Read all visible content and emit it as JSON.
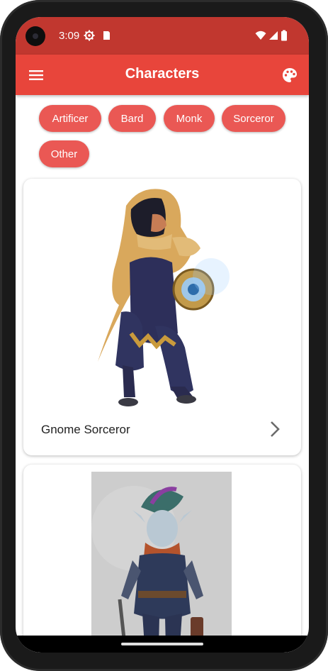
{
  "status": {
    "time": "3:09",
    "icons": [
      "settings-icon",
      "sd-card-icon",
      "wifi-icon",
      "signal-icon",
      "battery-icon"
    ]
  },
  "appbar": {
    "title": "Characters",
    "menu_icon": "menu-icon",
    "palette_icon": "palette-icon"
  },
  "filters": {
    "chips": [
      "Artificer",
      "Bard",
      "Monk",
      "Sorceror",
      "Other"
    ]
  },
  "cards": [
    {
      "label": "Gnome Sorceror",
      "icon": "chevron-right-icon"
    },
    {
      "label": ""
    }
  ],
  "colors": {
    "status_bar": "#c1372f",
    "app_bar": "#e8453b",
    "chip": "#ea5854"
  }
}
